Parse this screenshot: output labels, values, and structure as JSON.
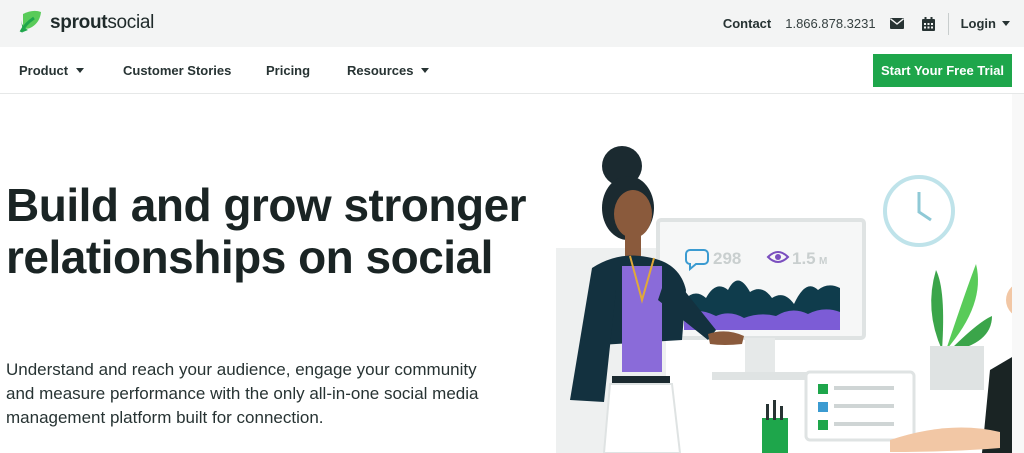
{
  "brand": {
    "name_bold": "sprout",
    "name_regular": "social",
    "color": "#1ea64b"
  },
  "topbar": {
    "contact_label": "Contact",
    "phone": "1.866.878.3231",
    "mail_icon": "envelope-icon",
    "calendar_icon": "calendar-icon",
    "login_label": "Login"
  },
  "nav": {
    "items": [
      {
        "label": "Product",
        "has_dropdown": true
      },
      {
        "label": "Customer Stories",
        "has_dropdown": false
      },
      {
        "label": "Pricing",
        "has_dropdown": false
      },
      {
        "label": "Resources",
        "has_dropdown": true
      }
    ],
    "cta_label": "Start Your Free Trial"
  },
  "hero": {
    "title": "Build and grow stronger relationships on social",
    "subtitle": "Understand and reach your audience, engage your community and measure performance with the only all-in-one social media management platform built for connection."
  },
  "illustration": {
    "comments_count": "298",
    "views_count": "1.5",
    "views_unit": "M"
  }
}
